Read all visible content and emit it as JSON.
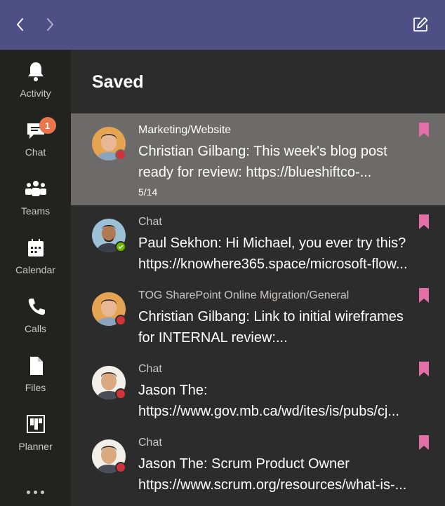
{
  "colors": {
    "topbar": "#4d4f85",
    "rail": "#222221",
    "main": "#2d2c2c",
    "selected": "#6d6b69",
    "bookmark": "#e36fa6",
    "badge": "#e9754a",
    "busy": "#d13438",
    "available": "#6bb700"
  },
  "topbar": {
    "back_icon": "chevron-left-icon",
    "forward_icon": "chevron-right-icon",
    "compose_icon": "compose-icon"
  },
  "rail": {
    "items": [
      {
        "label": "Activity",
        "icon": "bell-icon"
      },
      {
        "label": "Chat",
        "icon": "chat-icon",
        "badge": "1"
      },
      {
        "label": "Teams",
        "icon": "teams-icon"
      },
      {
        "label": "Calendar",
        "icon": "calendar-icon"
      },
      {
        "label": "Calls",
        "icon": "phone-icon"
      },
      {
        "label": "Files",
        "icon": "file-icon"
      },
      {
        "label": "Planner",
        "icon": "planner-icon"
      }
    ],
    "more_icon": "more-dots-icon"
  },
  "main": {
    "title": "Saved",
    "items": [
      {
        "meta": "Marketing/Website",
        "line1": "Christian Gilbang: This week's blog post",
        "line2": "ready for review: https://blueshiftco-...",
        "count": "5/14",
        "presence": "busy",
        "selected": true
      },
      {
        "meta": "Chat",
        "line1": "Paul Sekhon: Hi Michael, you ever try this?",
        "line2": "https://knowhere365.space/microsoft-flow...",
        "presence": "available"
      },
      {
        "meta": "TOG SharePoint Online Migration/General",
        "line1": "Christian Gilbang: Link to initial wireframes",
        "line2": "for INTERNAL review:...",
        "presence": "busy"
      },
      {
        "meta": "Chat",
        "line1": "Jason The:",
        "line2": "https://www.gov.mb.ca/wd/ites/is/pubs/cj...",
        "presence": "busy"
      },
      {
        "meta": "Chat",
        "line1": "Jason The: Scrum Product Owner",
        "line2": "https://www.scrum.org/resources/what-is-...",
        "presence": "busy"
      }
    ]
  }
}
